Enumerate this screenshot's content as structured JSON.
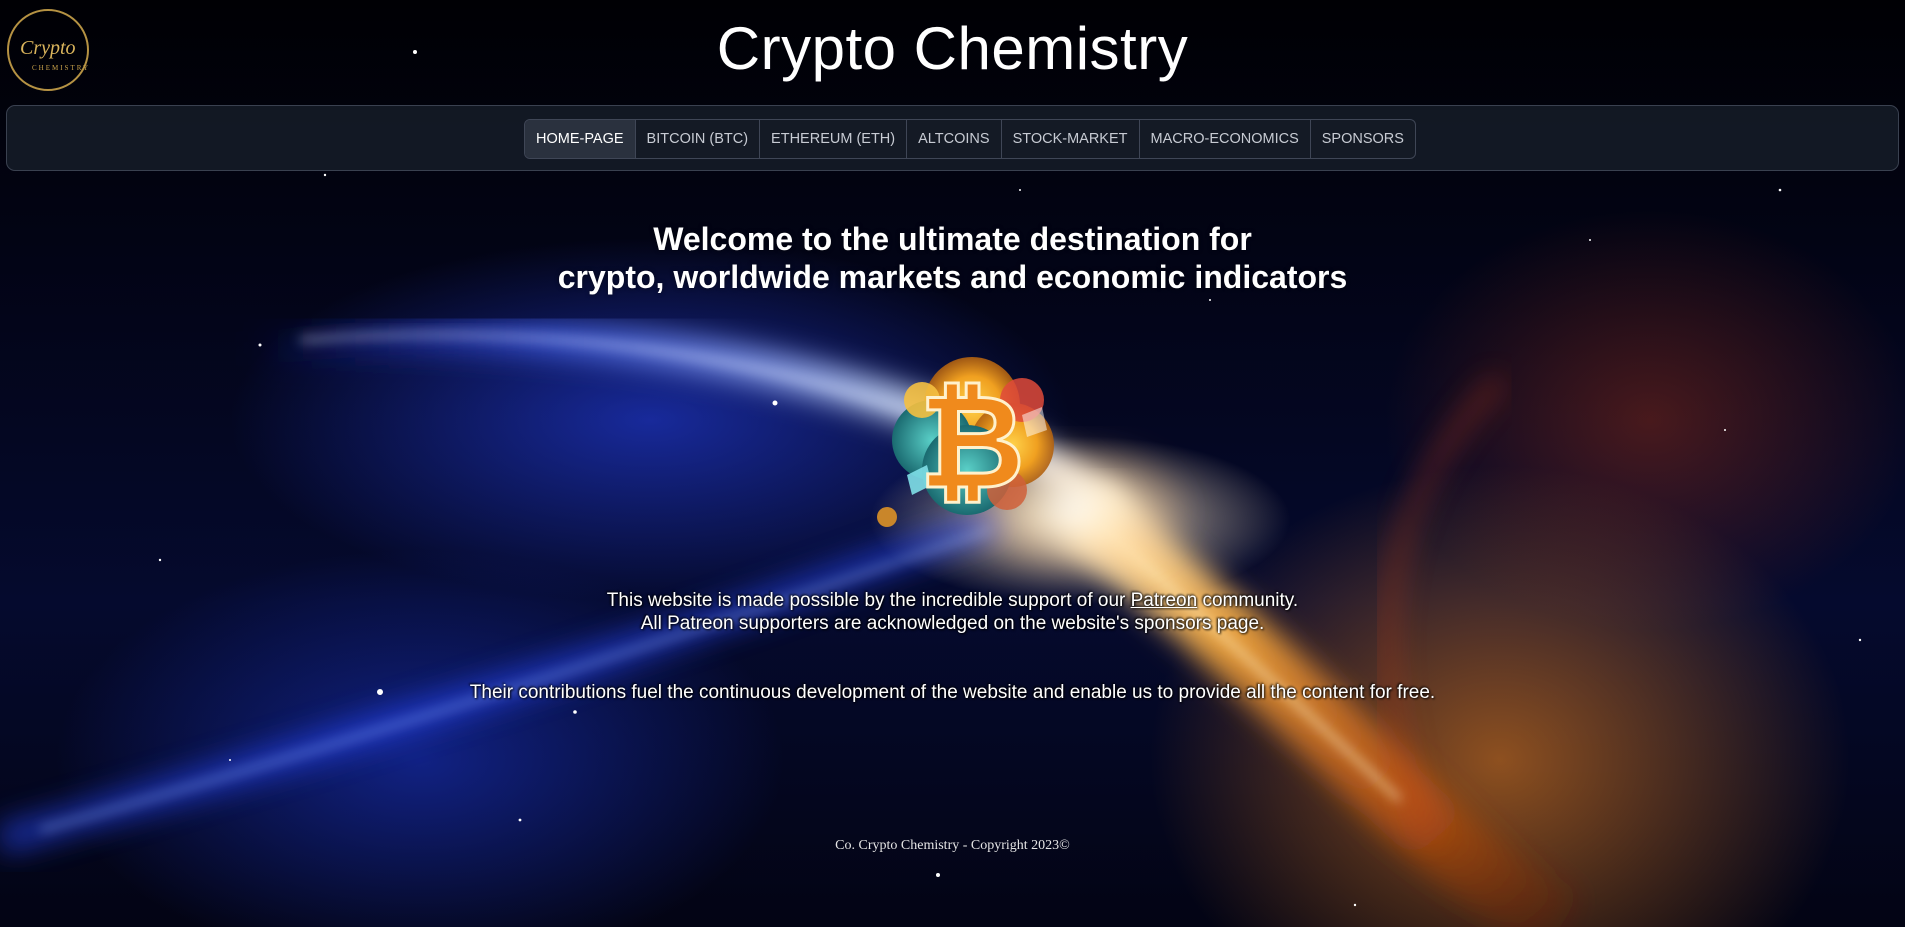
{
  "header": {
    "title": "Crypto Chemistry",
    "logo_text_top": "Crypto",
    "logo_text_bottom": "CHEMISTRY"
  },
  "nav": {
    "items": [
      {
        "label": "HOME-PAGE",
        "active": true
      },
      {
        "label": "BITCOIN (BTC)",
        "active": false
      },
      {
        "label": "ETHEREUM (ETH)",
        "active": false
      },
      {
        "label": "ALTCOINS",
        "active": false
      },
      {
        "label": "STOCK-MARKET",
        "active": false
      },
      {
        "label": "MACRO-ECONOMICS",
        "active": false
      },
      {
        "label": "SPONSORS",
        "active": false
      }
    ]
  },
  "main": {
    "welcome_line1": "Welcome to the ultimate destination for",
    "welcome_line2": "crypto, worldwide markets and economic indicators",
    "support_before": "This website is made possible by the incredible support of our ",
    "support_link": "Patreon",
    "support_after": " community.",
    "support_line2": "All Patreon supporters are acknowledged on the website's sponsors page.",
    "contributions": "Their contributions fuel the continuous development of the website and enable us to provide all the content for free.",
    "btc_symbol": "₿"
  },
  "footer": {
    "copyright": "Co. Crypto Chemistry - Copyright 2023©"
  },
  "colors": {
    "logo_gold": "#c9a24a",
    "navbar_bg": "#141a26",
    "nav_active_bg": "#2a313e",
    "accent_orange": "#f08a1c",
    "accent_blue": "#2a48ff"
  }
}
